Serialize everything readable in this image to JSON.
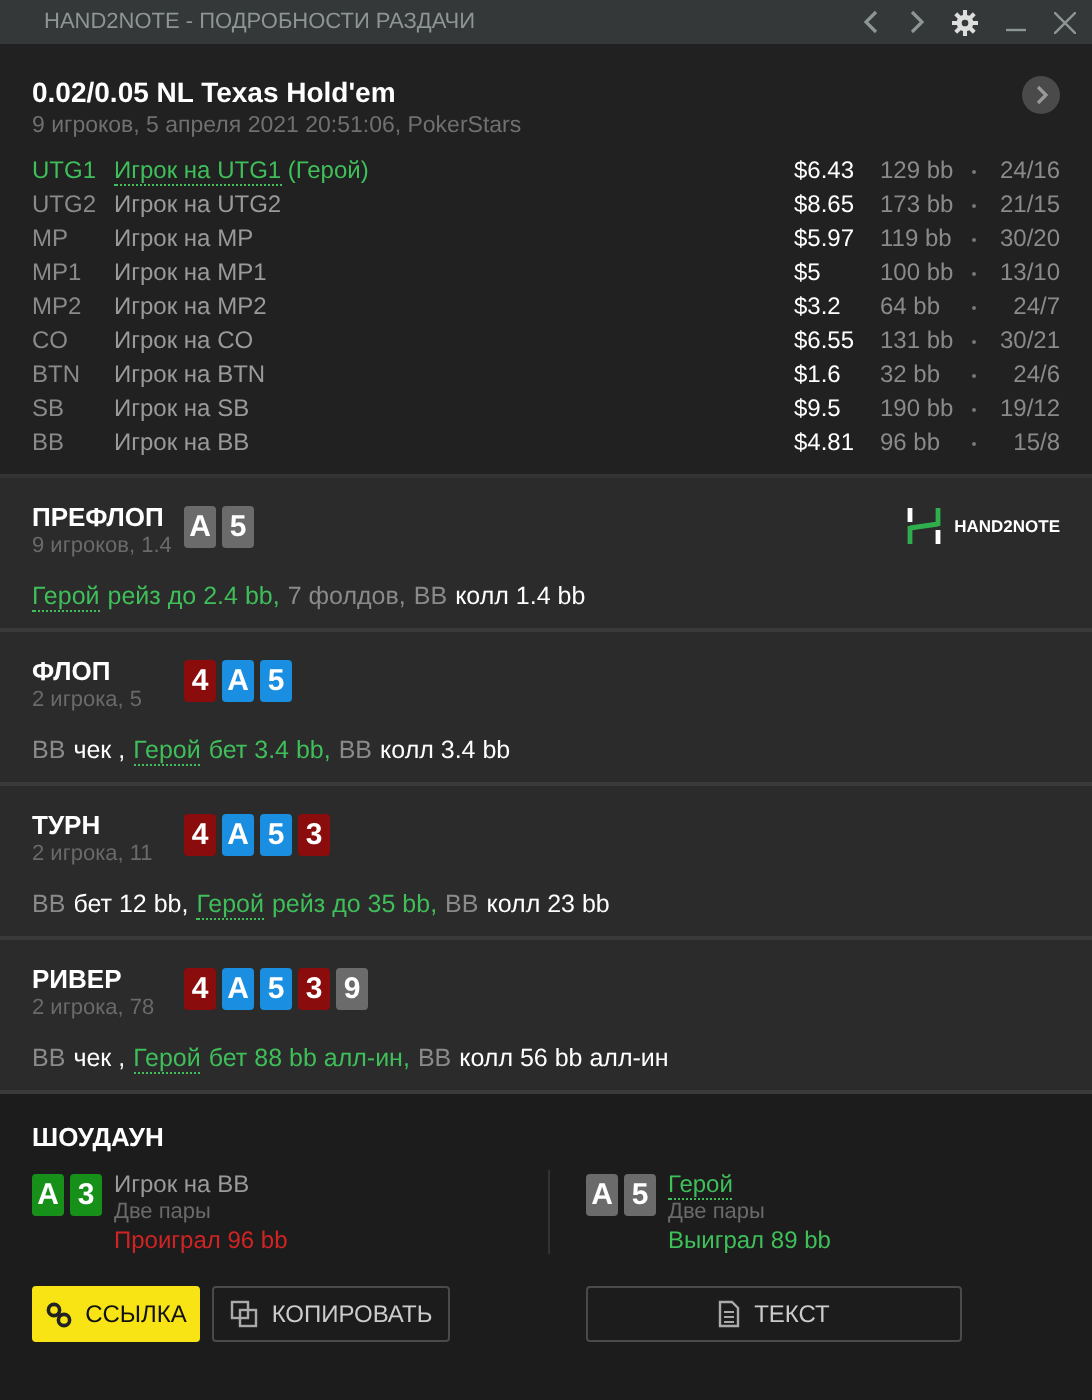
{
  "window": {
    "title": "HAND2NOTE - ПОДРОБНОСТИ РАЗДАЧИ"
  },
  "header": {
    "title": "0.02/0.05 NL Texas Hold'em",
    "subtitle": "9 игроков, 5 апреля 2021 20:51:06, PokerStars"
  },
  "players": [
    {
      "position": "UTG1",
      "name": "Игрок на UTG1",
      "tag": "(Герой)",
      "hero": true,
      "stack": "$6.43",
      "bb": "129 bb",
      "stats": "24/16"
    },
    {
      "position": "UTG2",
      "name": "Игрок на UTG2",
      "hero": false,
      "stack": "$8.65",
      "bb": "173 bb",
      "stats": "21/15"
    },
    {
      "position": "MP",
      "name": "Игрок на MP",
      "hero": false,
      "stack": "$5.97",
      "bb": "119 bb",
      "stats": "30/20"
    },
    {
      "position": "MP1",
      "name": "Игрок на MP1",
      "hero": false,
      "stack": "$5",
      "bb": "100 bb",
      "stats": "13/10"
    },
    {
      "position": "MP2",
      "name": "Игрок на MP2",
      "hero": false,
      "stack": "$3.2",
      "bb": "64 bb",
      "stats": "24/7"
    },
    {
      "position": "CO",
      "name": "Игрок на CO",
      "hero": false,
      "stack": "$6.55",
      "bb": "131 bb",
      "stats": "30/21"
    },
    {
      "position": "BTN",
      "name": "Игрок на BTN",
      "hero": false,
      "stack": "$1.6",
      "bb": "32 bb",
      "stats": "24/6"
    },
    {
      "position": "SB",
      "name": "Игрок на SB",
      "hero": false,
      "stack": "$9.5",
      "bb": "190 bb",
      "stats": "19/12"
    },
    {
      "position": "BB",
      "name": "Игрок на BB",
      "hero": false,
      "stack": "$4.81",
      "bb": "96 bb",
      "stats": "15/8"
    }
  ],
  "logo": {
    "text": "HAND2NOTE"
  },
  "streets": [
    {
      "name": "ПРЕФЛОП",
      "info": "9 игроков, 1.4",
      "logo": true,
      "cards": [
        {
          "rank": "A",
          "color": "#6b6b6b"
        },
        {
          "rank": "5",
          "color": "#6b6b6b"
        }
      ],
      "actions": [
        {
          "kind": "hero",
          "text": "Герой"
        },
        {
          "kind": "hero_action",
          "text": "рейз до 2.4 bb,"
        },
        {
          "kind": "player",
          "text": "7 фолдов,"
        },
        {
          "kind": "player",
          "text": "BB"
        },
        {
          "kind": "action",
          "text": "колл 1.4 bb"
        }
      ]
    },
    {
      "name": "ФЛОП",
      "info": "2 игрока, 5",
      "logo": false,
      "cards": [
        {
          "rank": "4",
          "color": "#8b0c0c"
        },
        {
          "rank": "A",
          "color": "#1a8ee0"
        },
        {
          "rank": "5",
          "color": "#1a8ee0"
        }
      ],
      "actions": [
        {
          "kind": "player",
          "text": "BB"
        },
        {
          "kind": "action",
          "text": "чек ,"
        },
        {
          "kind": "hero",
          "text": "Герой"
        },
        {
          "kind": "hero_action",
          "text": "бет 3.4 bb,"
        },
        {
          "kind": "player",
          "text": "BB"
        },
        {
          "kind": "action",
          "text": "колл 3.4 bb"
        }
      ]
    },
    {
      "name": "ТУРН",
      "info": "2 игрока, 11",
      "logo": false,
      "cards": [
        {
          "rank": "4",
          "color": "#8b0c0c"
        },
        {
          "rank": "A",
          "color": "#1a8ee0"
        },
        {
          "rank": "5",
          "color": "#1a8ee0"
        },
        {
          "rank": "3",
          "color": "#8b0c0c"
        }
      ],
      "actions": [
        {
          "kind": "player",
          "text": "BB"
        },
        {
          "kind": "action",
          "text": "бет 12 bb,"
        },
        {
          "kind": "hero",
          "text": "Герой"
        },
        {
          "kind": "hero_action",
          "text": "рейз до 35 bb,"
        },
        {
          "kind": "player",
          "text": "BB"
        },
        {
          "kind": "action",
          "text": "колл 23 bb"
        }
      ]
    },
    {
      "name": "РИВЕР",
      "info": "2 игрока, 78",
      "logo": false,
      "cards": [
        {
          "rank": "4",
          "color": "#8b0c0c"
        },
        {
          "rank": "A",
          "color": "#1a8ee0"
        },
        {
          "rank": "5",
          "color": "#1a8ee0"
        },
        {
          "rank": "3",
          "color": "#8b0c0c"
        },
        {
          "rank": "9",
          "color": "#6b6b6b"
        }
      ],
      "actions": [
        {
          "kind": "player",
          "text": "BB"
        },
        {
          "kind": "action",
          "text": "чек ,"
        },
        {
          "kind": "hero",
          "text": "Герой"
        },
        {
          "kind": "hero_action",
          "text": "бет 88 bb алл-ин,"
        },
        {
          "kind": "player",
          "text": "BB"
        },
        {
          "kind": "action",
          "text": "колл 56 bb алл-ин"
        }
      ]
    }
  ],
  "showdown": {
    "title": "ШОУДАУН",
    "hands": [
      {
        "name": "Игрок на BB",
        "hero": false,
        "combo": "Две пары",
        "won": false,
        "result": "Проиграл 96 bb",
        "cards": [
          {
            "rank": "A",
            "color": "#17901a"
          },
          {
            "rank": "3",
            "color": "#17901a"
          }
        ]
      },
      {
        "name": "Герой",
        "hero": true,
        "combo": "Две пары",
        "won": true,
        "result": "Выиграл 89 bb",
        "cards": [
          {
            "rank": "A",
            "color": "#6b6b6b"
          },
          {
            "rank": "5",
            "color": "#6b6b6b"
          }
        ]
      }
    ]
  },
  "buttons": [
    {
      "kind": "link",
      "label": "ССЫЛКА"
    },
    {
      "kind": "copy",
      "label": "КОПИРОВАТЬ"
    },
    {
      "kind": "text",
      "label": "ТЕКСТ"
    }
  ]
}
